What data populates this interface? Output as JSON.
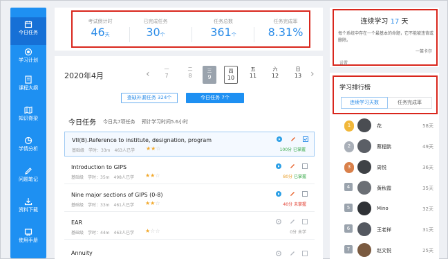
{
  "sidebar": {
    "items": [
      {
        "label": "今日任务",
        "icon": "calendar-icon"
      },
      {
        "label": "学习计划",
        "icon": "target-icon"
      },
      {
        "label": "课程大纲",
        "icon": "document-icon"
      },
      {
        "label": "知识脊梁",
        "icon": "map-icon"
      },
      {
        "label": "学情分析",
        "icon": "analysis-icon"
      },
      {
        "label": "问题笔记",
        "icon": "pencil-icon"
      },
      {
        "label": "资料下载",
        "icon": "download-icon"
      },
      {
        "label": "使用手册",
        "icon": "manual-icon"
      }
    ]
  },
  "stats": {
    "countdown": {
      "label": "考试倒计时",
      "value": "46",
      "unit": "天"
    },
    "completed": {
      "label": "已完成任务",
      "value": "30",
      "unit": "个"
    },
    "total": {
      "label": "任务总数",
      "value": "361",
      "unit": "个"
    },
    "rate": {
      "label": "任务完成率",
      "value": "8.31%"
    }
  },
  "calendar": {
    "month": "2020年4月",
    "prev": "‹",
    "next": "›",
    "days": [
      {
        "wd": "一",
        "d": "7"
      },
      {
        "wd": "二",
        "d": "8"
      },
      {
        "wd": "三",
        "d": "9"
      },
      {
        "wd": "四",
        "d": "10"
      },
      {
        "wd": "五",
        "d": "11"
      },
      {
        "wd": "六",
        "d": "12"
      },
      {
        "wd": "日",
        "d": "13"
      }
    ],
    "makeup_tab": "查缺补漏任务 324个",
    "today_tab": "今日任务 7个"
  },
  "tasks": {
    "title": "今日任务",
    "count_text": "今日共7项任务",
    "time_text": "预计学习时间5.6小时",
    "items": [
      {
        "name": "VII(B).Reference to institute, designation, program",
        "level": "基础级",
        "time": "学时：33m",
        "learners": "463人已学",
        "stars": 2,
        "score": "100分",
        "status": "已掌握",
        "status_color": "#35a845"
      },
      {
        "name": "Introduction to GIPS",
        "level": "基础级",
        "time": "学时：35m",
        "learners": "498人已学",
        "stars": 2,
        "score": "80分",
        "status": "已掌握",
        "status_color": "#35a845"
      },
      {
        "name": "Nine major sections of GIPS (0-8)",
        "level": "基础级",
        "time": "学时：33m",
        "learners": "461人已学",
        "stars": 2,
        "score": "40分",
        "status": "未掌握",
        "status_color": "#e0392b"
      },
      {
        "name": "EAR",
        "level": "基础级",
        "time": "学时：44m",
        "learners": "463人已学",
        "stars": 1,
        "score": "0分",
        "status": "未学",
        "status_color": "#999999"
      },
      {
        "name": "Annuity",
        "level": "",
        "time": "",
        "learners": "",
        "stars": 0,
        "score": "",
        "status": "",
        "status_color": "#999999"
      }
    ]
  },
  "streak": {
    "prefix": "连续学习",
    "days": "17",
    "suffix": "天",
    "quote": "每个系统中存在一个最基本的命题，它不能被违背或删除。",
    "author": "一笛卡尔",
    "settings": "设置"
  },
  "ranking": {
    "title": "学习排行榜",
    "tab_days": "连续学习天数",
    "tab_rate": "任务完成率",
    "rows": [
      {
        "rank": "1",
        "name": "花",
        "days": "58天",
        "medal": "#f1b73a"
      },
      {
        "rank": "2",
        "name": "蔡程鹏",
        "days": "49天",
        "medal": "#a9afb8"
      },
      {
        "rank": "3",
        "name": "周悦",
        "days": "36天",
        "medal": "#d9804a"
      },
      {
        "rank": "4",
        "name": "黄秋霞",
        "days": "35天",
        "medal": "#9aa3ad"
      },
      {
        "rank": "5",
        "name": "Mino",
        "days": "32天",
        "medal": "#9aa3ad"
      },
      {
        "rank": "6",
        "name": "王老祥",
        "days": "31天",
        "medal": "#9aa3ad"
      },
      {
        "rank": "7",
        "name": "赵文悦",
        "days": "25天",
        "medal": "#9aa3ad"
      }
    ]
  },
  "colors": {
    "accent": "#1e90f2",
    "highlight_border": "#d9261c"
  }
}
